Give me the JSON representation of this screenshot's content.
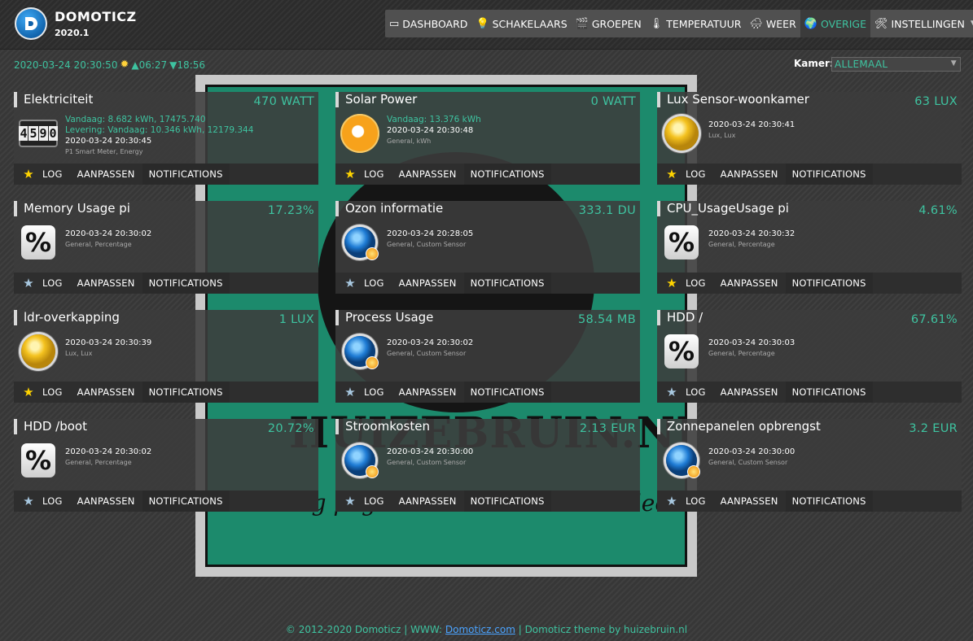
{
  "header": {
    "app_name": "DOMOTICZ",
    "version": "2020.1"
  },
  "nav": [
    {
      "label": "DASHBOARD",
      "icon": "dashboard-icon",
      "glyph": "▭",
      "active": false
    },
    {
      "label": "SCHAKELAARS",
      "icon": "lightbulb-icon",
      "glyph": "💡",
      "active": false
    },
    {
      "label": "GROEPEN",
      "icon": "clapperboard-icon",
      "glyph": "🎬",
      "active": false
    },
    {
      "label": "TEMPERATUUR",
      "icon": "thermometer-icon",
      "glyph": "🌡",
      "active": false
    },
    {
      "label": "WEER",
      "icon": "weather-icon",
      "glyph": "🌧",
      "active": false
    },
    {
      "label": "OVERIGE",
      "icon": "utility-icon",
      "glyph": "🌍",
      "active": true
    },
    {
      "label": "INSTELLINGEN",
      "icon": "tools-icon",
      "glyph": "🛠",
      "active": false,
      "dropdown": true
    }
  ],
  "status": {
    "datetime": "2020-03-24 20:30:50",
    "sunrise": "▲06:27",
    "sunset": "▼18:56"
  },
  "room_filter": {
    "label": "Kamer:",
    "selected": "ALLEMAAL"
  },
  "actions": {
    "log": "LOG",
    "edit": "AANPASSEN",
    "notifications": "NOTIFICATIONS"
  },
  "devices": [
    {
      "name": "Elektriciteit",
      "value": "470 WATT",
      "icon": "meter",
      "favorite": true,
      "lines": [
        "Vandaag: 8.682 kWh, 17475.740",
        "Levering: Vandaag: 10.346 kWh, 12179.344"
      ],
      "last_update": "2020-03-24 20:30:45",
      "type": "P1 Smart Meter, Energy"
    },
    {
      "name": "Solar Power",
      "value": "0 WATT",
      "icon": "solar",
      "favorite": true,
      "lines": [
        "Vandaag: 13.376 kWh"
      ],
      "last_update": "2020-03-24 20:30:48",
      "type": "General, kWh"
    },
    {
      "name": "Lux Sensor-woonkamer",
      "value": "63 LUX",
      "icon": "lux",
      "favorite": true,
      "lines": [],
      "last_update": "2020-03-24 20:30:41",
      "type": "Lux, Lux"
    },
    {
      "name": "Memory Usage pi",
      "value": "17.23%",
      "icon": "percent",
      "favorite": false,
      "lines": [],
      "last_update": "2020-03-24 20:30:02",
      "type": "General, Percentage"
    },
    {
      "name": "Ozon informatie",
      "value": "333.1 DU",
      "icon": "globe",
      "favorite": false,
      "lines": [],
      "last_update": "2020-03-24 20:28:05",
      "type": "General, Custom Sensor"
    },
    {
      "name": "CPU_UsageUsage pi",
      "value": "4.61%",
      "icon": "percent",
      "favorite": true,
      "lines": [],
      "last_update": "2020-03-24 20:30:32",
      "type": "General, Percentage"
    },
    {
      "name": "ldr-overkapping",
      "value": "1 LUX",
      "icon": "lux",
      "favorite": true,
      "lines": [],
      "last_update": "2020-03-24 20:30:39",
      "type": "Lux, Lux"
    },
    {
      "name": "Process Usage",
      "value": "58.54 MB",
      "icon": "globe",
      "favorite": false,
      "lines": [],
      "last_update": "2020-03-24 20:30:02",
      "type": "General, Custom Sensor"
    },
    {
      "name": "HDD /",
      "value": "67.61%",
      "icon": "percent",
      "favorite": false,
      "lines": [],
      "last_update": "2020-03-24 20:30:03",
      "type": "General, Percentage"
    },
    {
      "name": "HDD /boot",
      "value": "20.72%",
      "icon": "percent",
      "favorite": false,
      "lines": [],
      "last_update": "2020-03-24 20:30:02",
      "type": "General, Percentage"
    },
    {
      "name": "Stroomkosten",
      "value": "2.13 EUR",
      "icon": "globe",
      "favorite": false,
      "lines": [],
      "last_update": "2020-03-24 20:30:00",
      "type": "General, Custom Sensor"
    },
    {
      "name": "Zonnepanelen opbrengst",
      "value": "3.2 EUR",
      "icon": "globe",
      "favorite": false,
      "lines": [],
      "last_update": "2020-03-24 20:30:00",
      "type": "General, Custom Sensor"
    }
  ],
  "meter_digits": [
    "4",
    "5",
    "9",
    "0"
  ],
  "watermark": {
    "title": "HUIZEBRUIN.NL",
    "subtitle": "Een blog pagina over Domoticz & electronica"
  },
  "footer": {
    "prefix": "© 2012-2020 Domoticz | WWW: ",
    "link": "Domoticz.com",
    "suffix": " | Domoticz theme by huizebruin.nl"
  },
  "colors": {
    "accent": "#3ec3a0",
    "favorite": "#ffd400",
    "link": "#4aa3ff"
  }
}
